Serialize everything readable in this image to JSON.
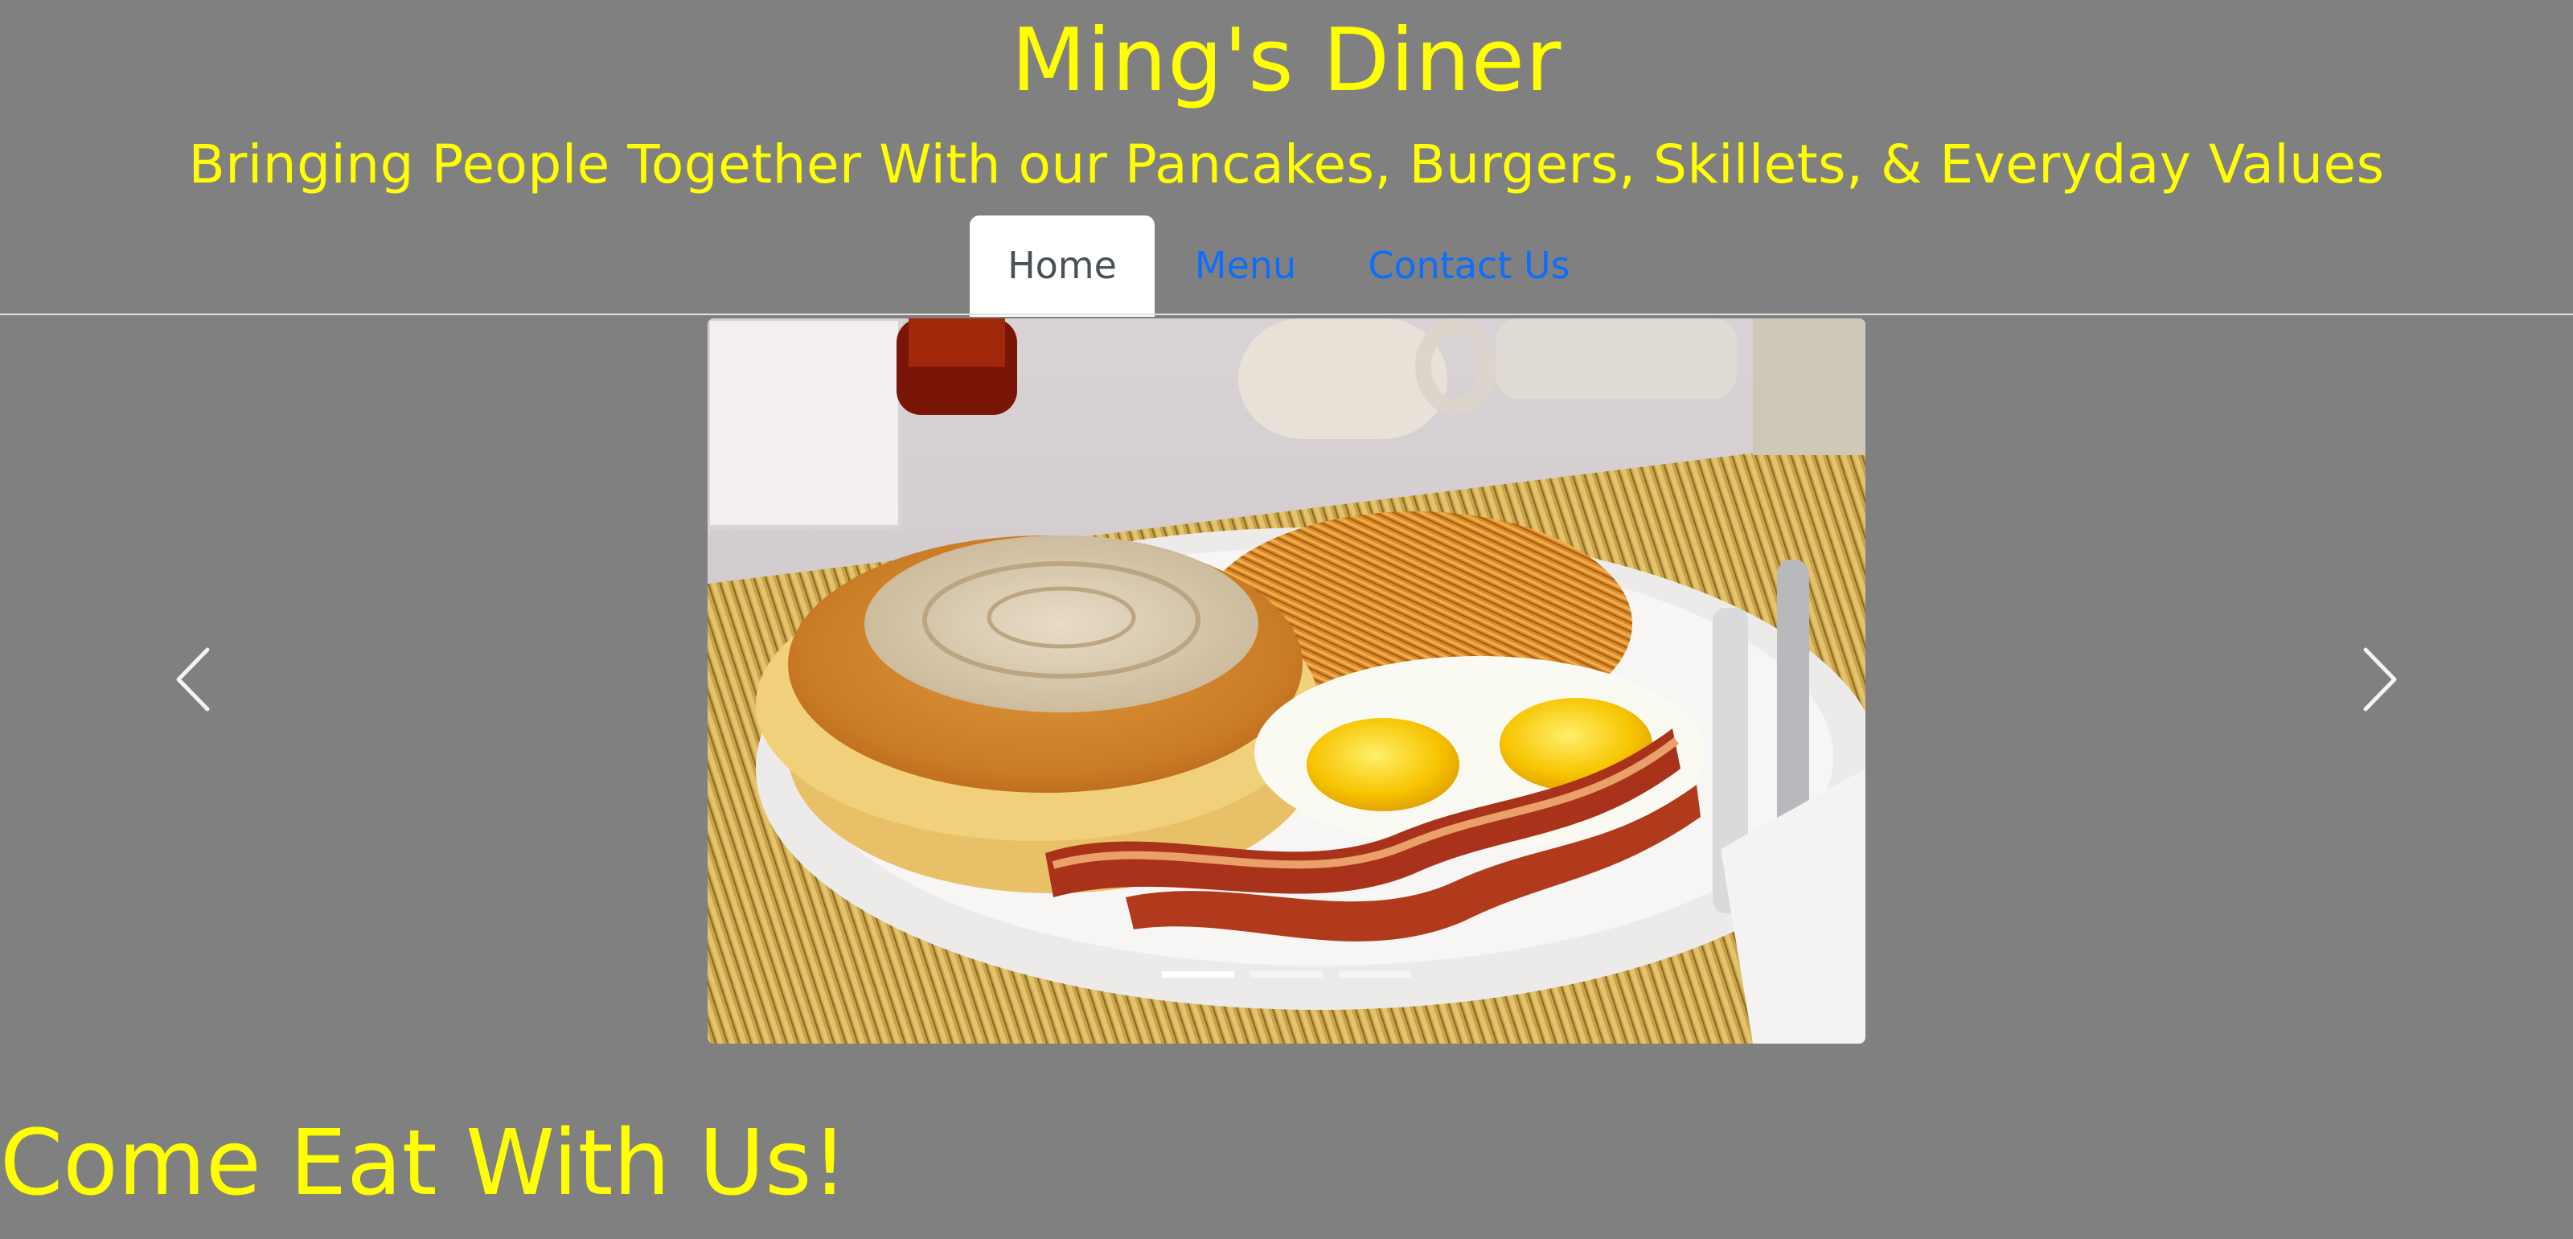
{
  "header": {
    "title": "Ming's Diner",
    "tagline": "Bringing People Together With our Pancakes, Burgers, Skillets, & Everyday Values"
  },
  "nav": {
    "tabs": [
      {
        "label": "Home",
        "active": true
      },
      {
        "label": "Menu",
        "active": false
      },
      {
        "label": "Contact Us",
        "active": false
      }
    ]
  },
  "carousel": {
    "image_description_icon": "breakfast-plate-photo",
    "slide_count": 3,
    "active_slide": 1,
    "prev_icon": "chevron-left-icon",
    "next_icon": "chevron-right-icon"
  },
  "main": {
    "cta_heading": "Come Eat With Us!"
  },
  "colors": {
    "background": "#808080",
    "title": "#ffff00",
    "link": "#0d6efd",
    "active_tab_bg": "#ffffff",
    "active_tab_text": "#495057"
  }
}
